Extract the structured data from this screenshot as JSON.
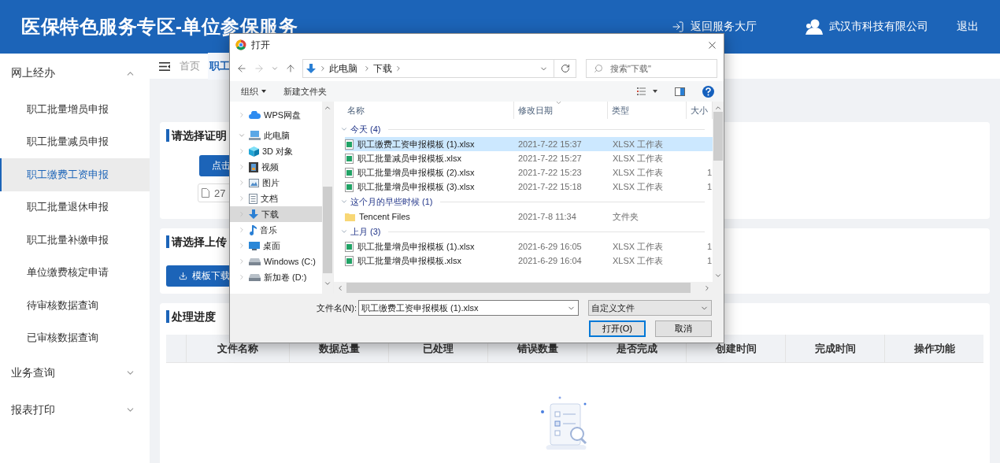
{
  "header": {
    "title": "医保特色服务专区-单位参保服务",
    "links": [
      {
        "kind": "return",
        "label": "返回服务大厅"
      },
      {
        "kind": "user",
        "label": "武汉市科技有限公司"
      },
      {
        "kind": "plain",
        "label": "退出"
      }
    ]
  },
  "sidebar": {
    "groups": [
      {
        "label": "网上经办",
        "expanded": true,
        "items": [
          {
            "label": "职工批量增员申报",
            "selected": false
          },
          {
            "label": "职工批量减员申报",
            "selected": false
          },
          {
            "label": "职工缴费工资申报",
            "selected": true
          },
          {
            "label": "职工批量退休申报",
            "selected": false
          },
          {
            "label": "职工批量补缴申报",
            "selected": false
          },
          {
            "label": "单位缴费核定申请",
            "selected": false
          },
          {
            "label": "待审核数据查询",
            "selected": false
          },
          {
            "label": "已审核数据查询",
            "selected": false
          }
        ]
      },
      {
        "label": "业务查询",
        "expanded": false
      },
      {
        "label": "报表打印",
        "expanded": false
      }
    ]
  },
  "breadcrumb": [
    {
      "label": "首页",
      "selected": false
    },
    {
      "label": "职工",
      "selected": true
    }
  ],
  "proof_card": {
    "title": "请选择证明",
    "button": "点击",
    "file": "27"
  },
  "upload_card": {
    "title": "请选择上传",
    "button": "模板下载"
  },
  "progress_card": {
    "title": "处理进度",
    "columns": [
      "文件名称",
      "数据总量",
      "已处理",
      "错误数量",
      "是否完成",
      "创建时间",
      "完成时间",
      "操作功能"
    ]
  },
  "dialog": {
    "title": "打开",
    "path": [
      "此电脑",
      "下载"
    ],
    "search_placeholder": "搜索\"下载\"",
    "toolbar": [
      "组织",
      "新建文件夹"
    ],
    "nav": [
      {
        "label": "WPS网盘",
        "kind": "cloud",
        "expanded": false,
        "selected": false
      },
      {
        "label": "此电脑",
        "kind": "pc",
        "expanded": true,
        "selected": false,
        "children": [
          {
            "label": "3D 对象",
            "kind": "cube",
            "expanded": false,
            "selected": false
          },
          {
            "label": "视频",
            "kind": "film",
            "expanded": false,
            "selected": false
          },
          {
            "label": "图片",
            "kind": "image",
            "expanded": false,
            "selected": false
          },
          {
            "label": "文档",
            "kind": "doc",
            "expanded": false,
            "selected": false
          },
          {
            "label": "下载",
            "kind": "download",
            "expanded": false,
            "selected": true
          },
          {
            "label": "音乐",
            "kind": "music",
            "expanded": false,
            "selected": false
          },
          {
            "label": "桌面",
            "kind": "desktop",
            "expanded": false,
            "selected": false
          },
          {
            "label": "Windows (C:)",
            "kind": "drive",
            "expanded": false,
            "selected": false
          },
          {
            "label": "新加卷 (D:)",
            "kind": "drive",
            "expanded": false,
            "selected": false
          }
        ]
      }
    ],
    "columns": [
      "名称",
      "修改日期",
      "类型",
      "大小"
    ],
    "groups": [
      {
        "label": "今天 (4)",
        "expanded": true,
        "files": [
          {
            "kind": "xlsx",
            "name": "职工缴费工资申报模板 (1).xlsx",
            "date": "2021-7-22 15:37",
            "type": "XLSX 工作表",
            "selected": true
          },
          {
            "kind": "xlsx",
            "name": "职工批量减员申报模板.xlsx",
            "date": "2021-7-22 15:27",
            "type": "XLSX 工作表",
            "selected": false
          },
          {
            "kind": "xlsx",
            "name": "职工批量增员申报模板 (2).xlsx",
            "date": "2021-7-22 15:23",
            "type": "XLSX 工作表",
            "size": "1",
            "selected": false
          },
          {
            "kind": "xlsx",
            "name": "职工批量增员申报模板 (3).xlsx",
            "date": "2021-7-22 15:18",
            "type": "XLSX 工作表",
            "size": "1",
            "selected": false
          }
        ]
      },
      {
        "label": "这个月的早些时候 (1)",
        "expanded": true,
        "files": [
          {
            "kind": "folder",
            "name": "Tencent Files",
            "date": "2021-7-8 11:34",
            "type": "文件夹",
            "selected": false
          }
        ]
      },
      {
        "label": "上月 (3)",
        "expanded": true,
        "files": [
          {
            "kind": "xlsx",
            "name": "职工批量增员申报模板 (1).xlsx",
            "date": "2021-6-29 16:05",
            "type": "XLSX 工作表",
            "size": "1",
            "selected": false
          },
          {
            "kind": "xlsx",
            "name": "职工批量增员申报模板.xlsx",
            "date": "2021-6-29 16:04",
            "type": "XLSX 工作表",
            "size": "1",
            "selected": false
          }
        ]
      }
    ],
    "filename_label": "文件名(N):",
    "filename": "职工缴费工资申报模板 (1).xlsx",
    "filter": "自定义文件",
    "buttons": [
      {
        "kind": "default",
        "label": "打开(O)"
      },
      {
        "kind": "normal",
        "label": "取消"
      }
    ]
  }
}
